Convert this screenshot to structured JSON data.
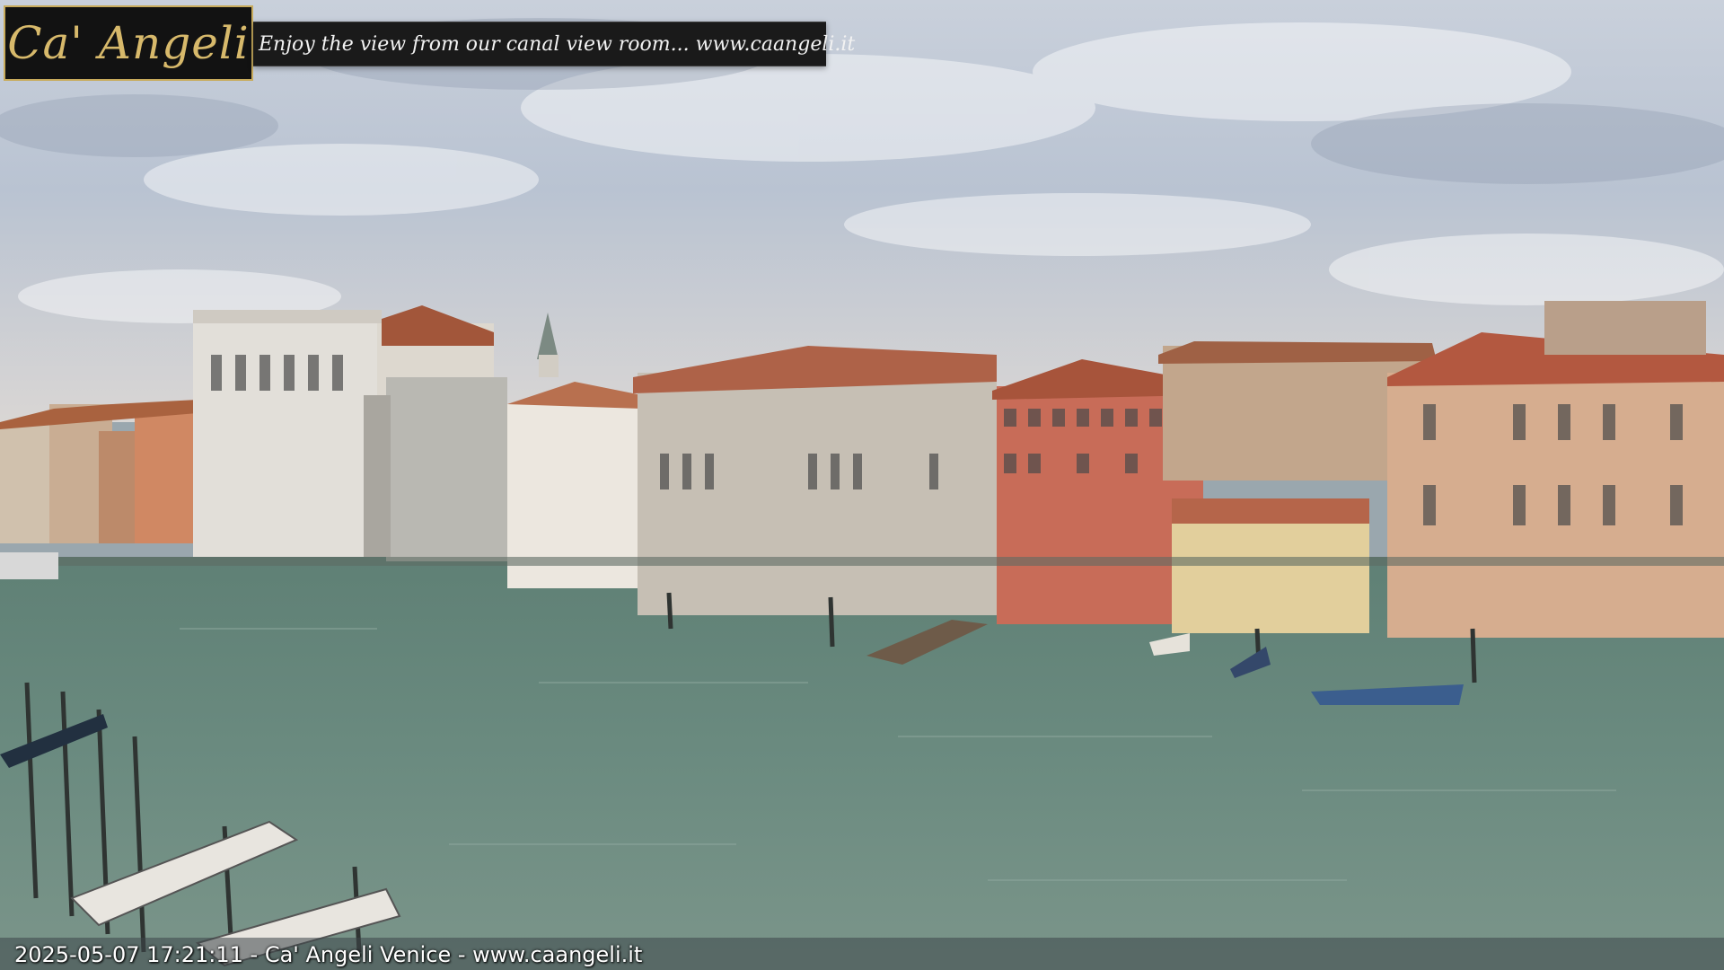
{
  "overlay": {
    "logo": "Ca' Angeli",
    "tagline": "Enjoy the view from our canal view room... www.caangeli.it",
    "timestamp_caption": "2025-05-07 17:21:11 - Ca' Angeli Venice - www.caangeli.it"
  },
  "colors": {
    "sky": "#c7ced8",
    "water": "#6f8c80",
    "logo_gold": "#d7b96b",
    "banner_bg": "#121212"
  }
}
